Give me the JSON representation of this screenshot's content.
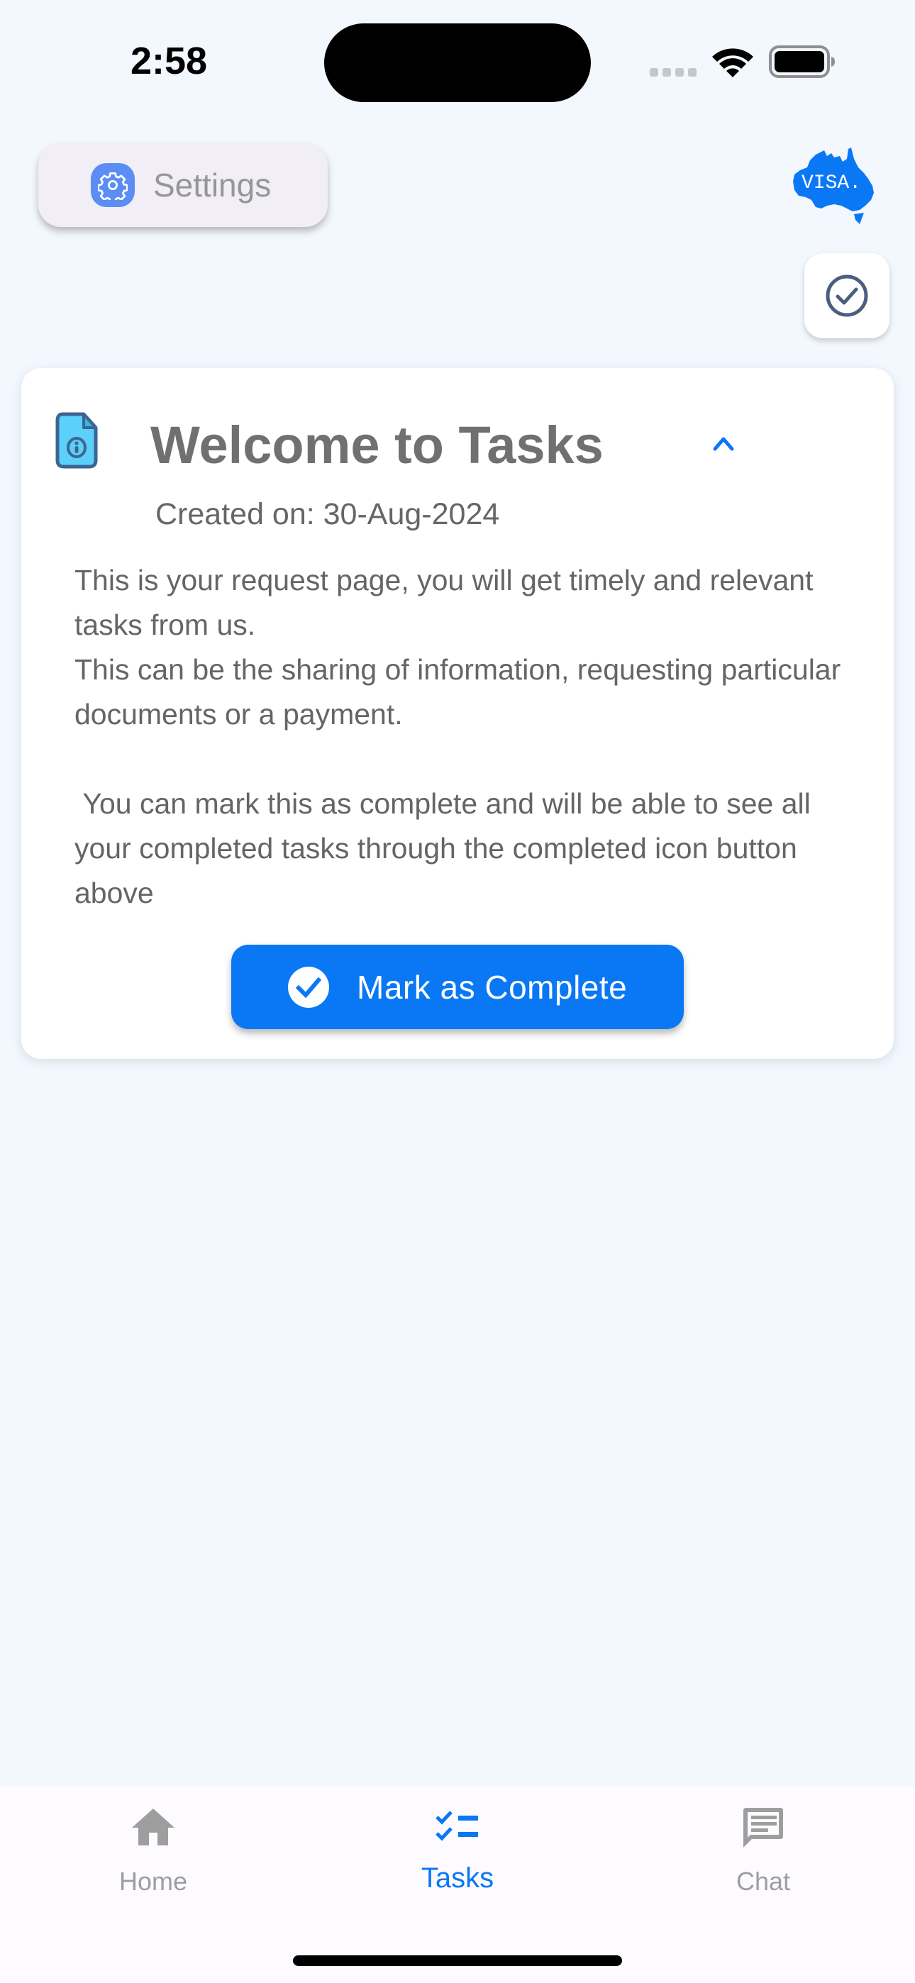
{
  "status_bar": {
    "time": "2:58",
    "icons": [
      "signal-icon",
      "wifi-icon",
      "battery-icon"
    ]
  },
  "header": {
    "settings_label": "Settings",
    "settings_icon": "gear-icon",
    "logo_text": "VISA.",
    "logo_icon": "australia-map-logo",
    "completed_button_icon": "check-circle-icon",
    "colors": {
      "settings_icon_bg": "#5b8df5",
      "logo": "#0a78f5"
    }
  },
  "task_card": {
    "icon": "document-info-icon",
    "title": "Welcome to Tasks",
    "expanded": true,
    "chevron_icon": "chevron-up-icon",
    "created_on": "Created on: 30-Aug-2024",
    "body": [
      "This is your request page, you will get timely and relevant tasks from us.",
      "This can be the sharing of information, requesting particular documents or a payment.",
      "",
      " You can mark this as complete and will be able to see all your completed tasks through the completed icon button above"
    ],
    "action_button": {
      "label": "Mark as Complete",
      "icon": "check-circle-icon",
      "color": "#0a78f5"
    }
  },
  "tab_bar": {
    "active_index": 1,
    "active_color": "#0a78f5",
    "inactive_color": "#9e9e9e",
    "tabs": [
      {
        "label": "Home",
        "icon": "home-icon"
      },
      {
        "label": "Tasks",
        "icon": "checklist-icon"
      },
      {
        "label": "Chat",
        "icon": "chat-icon"
      }
    ]
  }
}
